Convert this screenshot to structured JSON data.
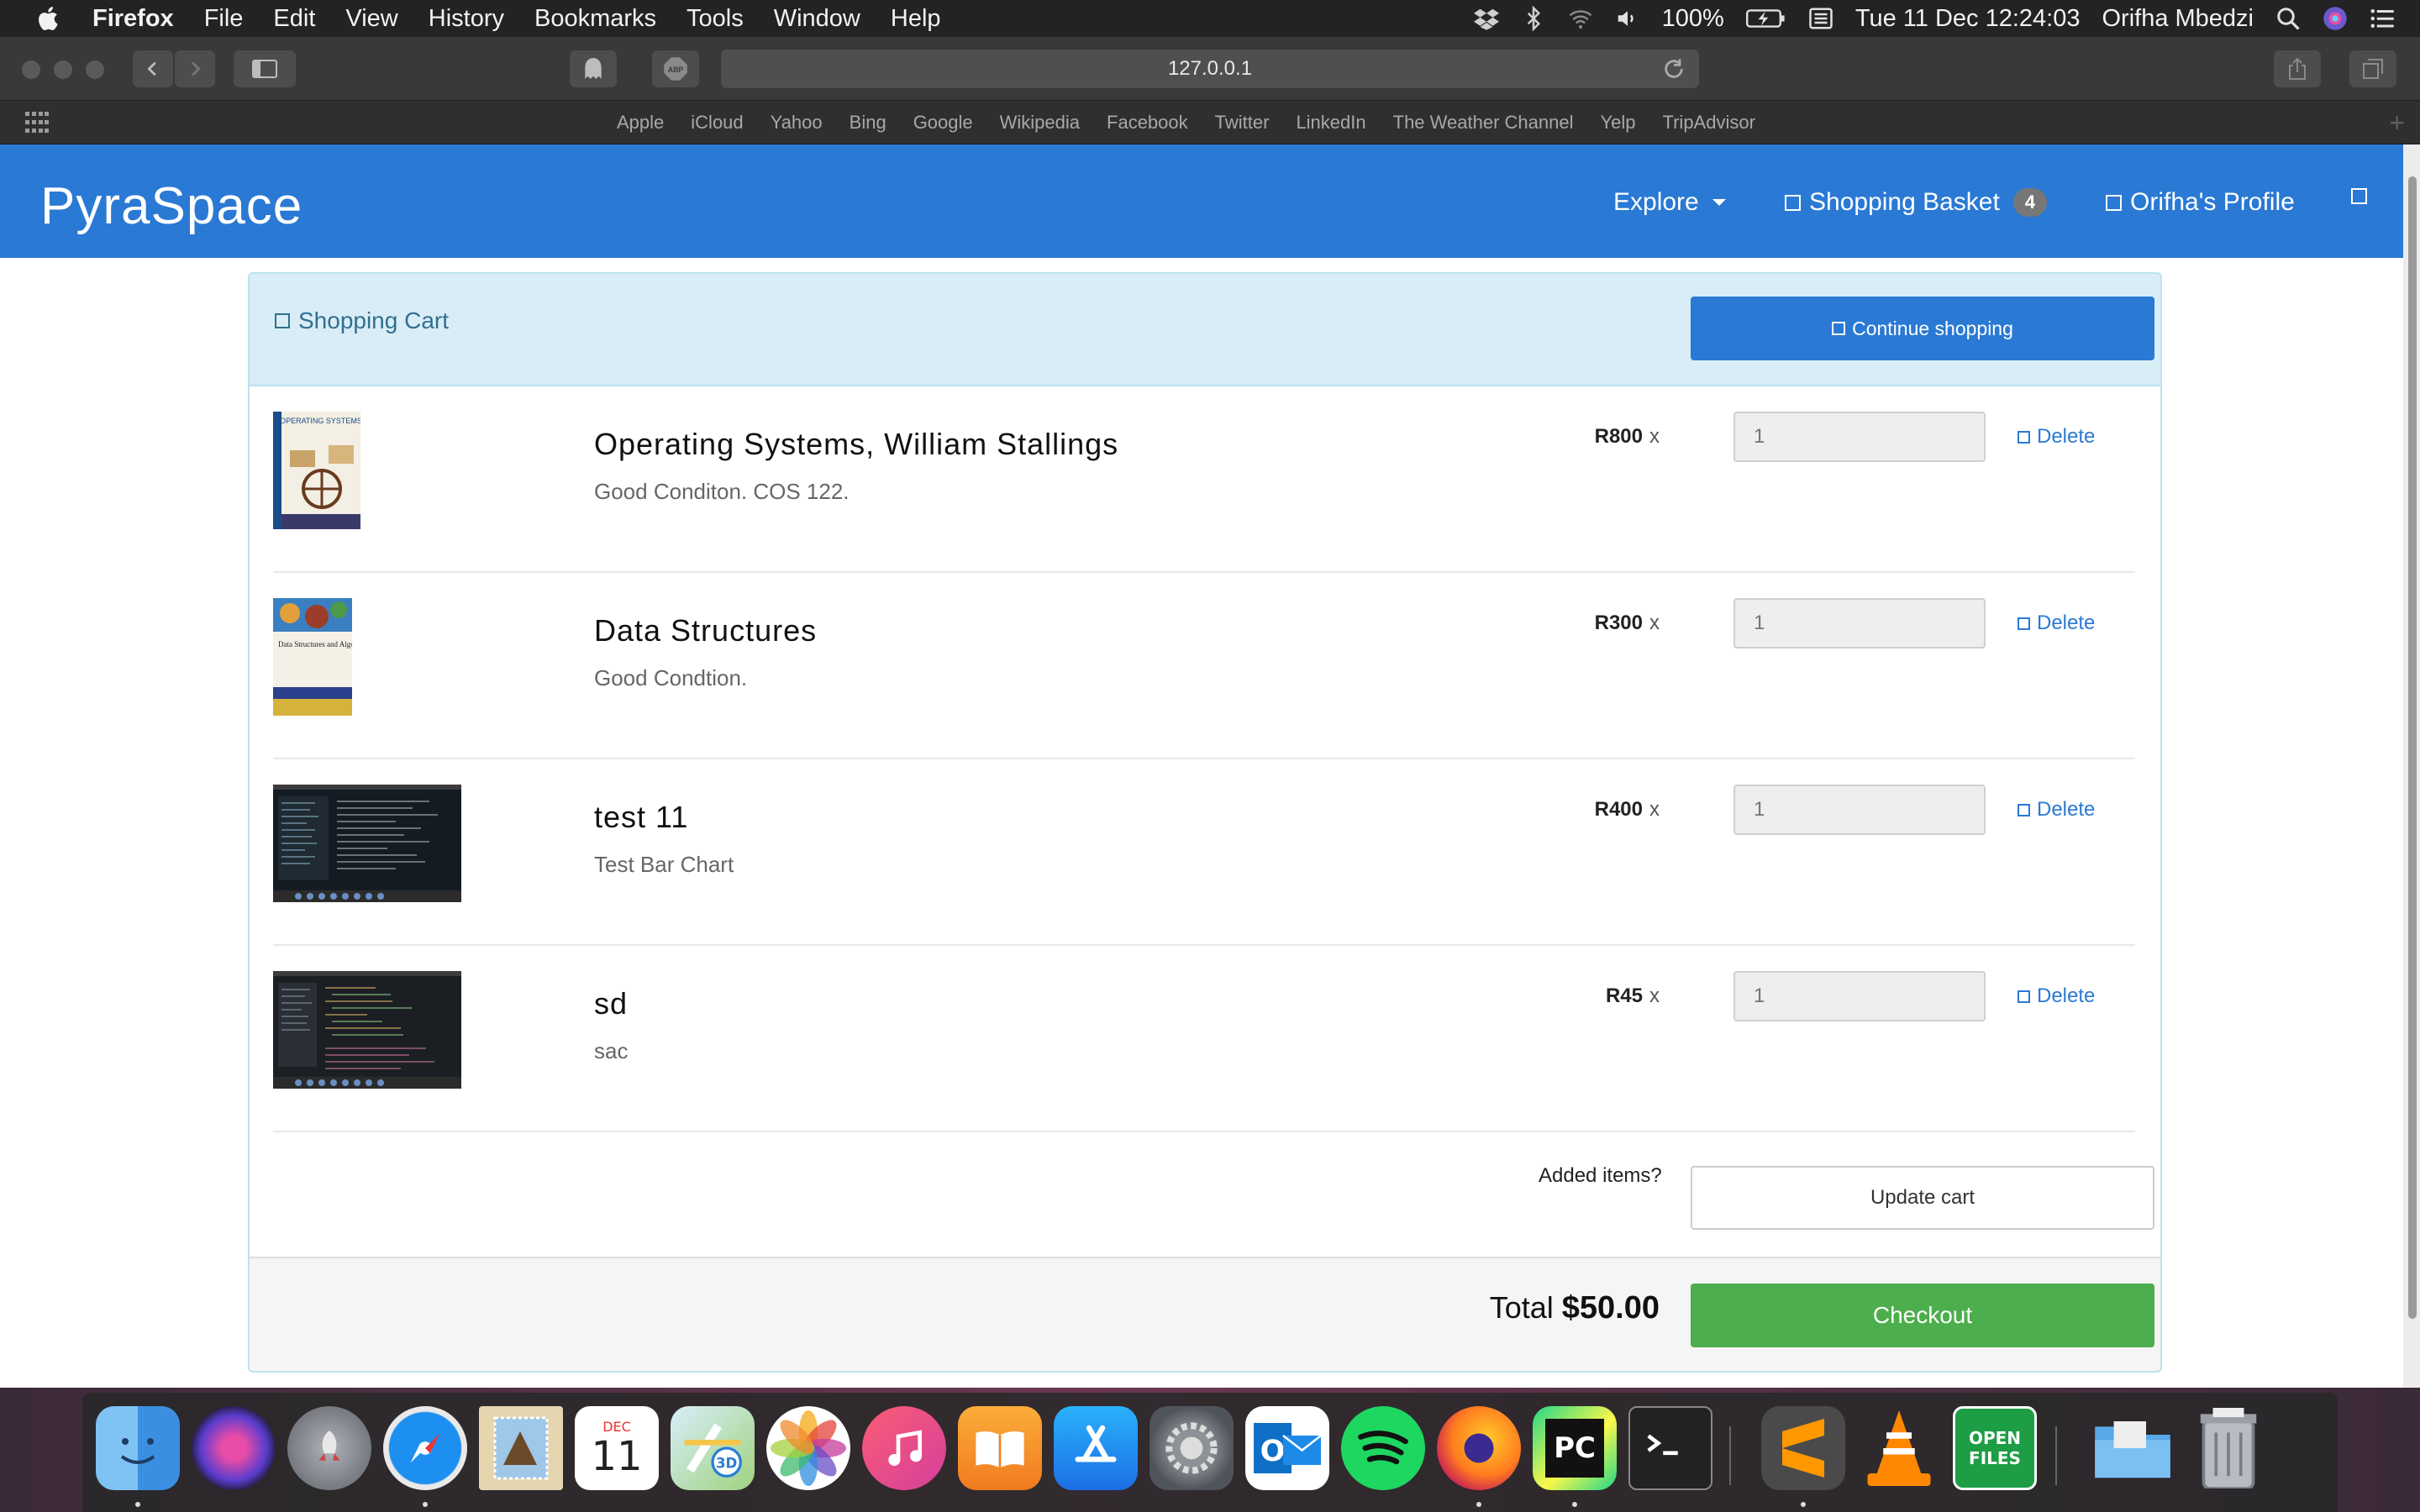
{
  "menubar": {
    "app": "Firefox",
    "menus": [
      "File",
      "Edit",
      "View",
      "History",
      "Bookmarks",
      "Tools",
      "Window",
      "Help"
    ],
    "battery": "100%",
    "datetime": "Tue 11 Dec  12:24:03",
    "user": "Orifha Mbedzi"
  },
  "browser": {
    "url": "127.0.0.1",
    "bookmarks": [
      "Apple",
      "iCloud",
      "Yahoo",
      "Bing",
      "Google",
      "Wikipedia",
      "Facebook",
      "Twitter",
      "LinkedIn",
      "The Weather Channel",
      "Yelp",
      "TripAdvisor"
    ]
  },
  "navbar": {
    "brand": "PyraSpace",
    "explore": "Explore",
    "basket_label": "Shopping Basket",
    "basket_count": "4",
    "profile": "Orifha's Profile"
  },
  "cart": {
    "title": "Shopping Cart",
    "continue_label": "Continue shopping",
    "delete_label": "Delete",
    "items": [
      {
        "name": "Operating Systems, William Stallings",
        "desc": "Good Conditon. COS 122.",
        "price": "R800",
        "qty": "1"
      },
      {
        "name": "Data Structures",
        "desc": "Good Condtion.",
        "price": "R300",
        "qty": "1"
      },
      {
        "name": "test 11",
        "desc": "Test Bar Chart",
        "price": "R400",
        "qty": "1"
      },
      {
        "name": "sd",
        "desc": "sac",
        "price": "R45",
        "qty": "1"
      }
    ],
    "thumbs": {
      "book1_title": "OPERATING SYSTEMS",
      "book2_title": "Data Structures and Algorithms"
    },
    "added_items_label": "Added items?",
    "update_label": "Update cart",
    "total_label": "Total",
    "total_value": "$50.00",
    "checkout_label": "Checkout"
  },
  "dock": {
    "calendar_month": "DEC",
    "calendar_day": "11",
    "openfiles_label": "OPEN FILES",
    "pycharm_label": "PC"
  },
  "colors": {
    "primary": "#2a79d4",
    "success": "#4cae4c",
    "panel_head": "#d9edf7"
  }
}
